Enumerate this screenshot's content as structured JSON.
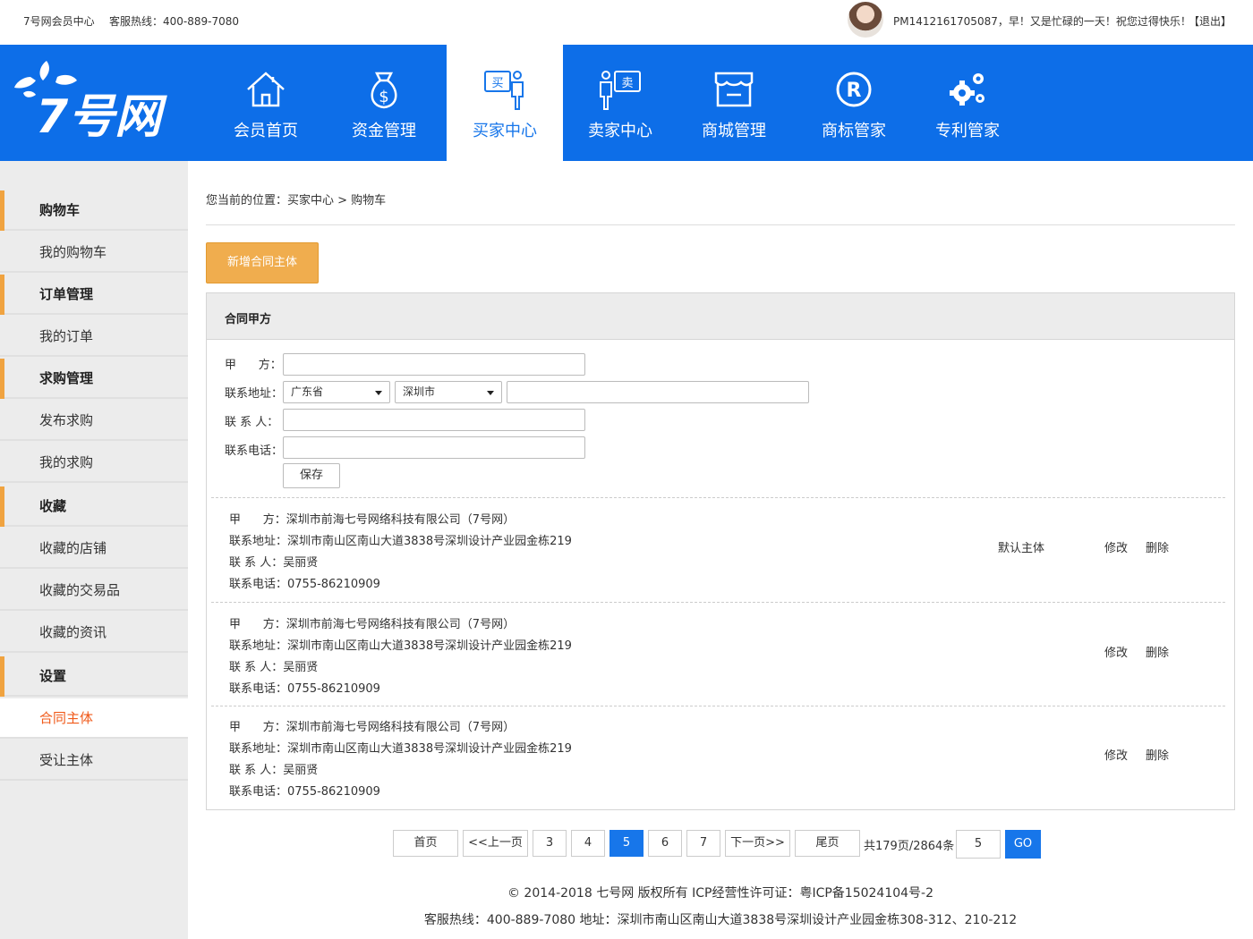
{
  "topbar": {
    "site_name": "7号网会员中心",
    "hotline": "客服热线：400-889-7080",
    "greeting": "PM1412161705087，早！又是忙碌的一天！祝您过得快乐！",
    "logout": "【退出】"
  },
  "logo": {
    "text": "7号网"
  },
  "nav": {
    "items": [
      {
        "label": "会员首页",
        "icon": "home-icon"
      },
      {
        "label": "资金管理",
        "icon": "money-bag-icon"
      },
      {
        "label": "买家中心",
        "icon": "buyer-icon",
        "active": true
      },
      {
        "label": "卖家中心",
        "icon": "seller-icon"
      },
      {
        "label": "商城管理",
        "icon": "store-icon"
      },
      {
        "label": "商标管家",
        "icon": "trademark-icon"
      },
      {
        "label": "专利管家",
        "icon": "gears-icon"
      }
    ]
  },
  "sidebar": {
    "items": [
      {
        "label": "购物车",
        "type": "head"
      },
      {
        "label": "我的购物车",
        "type": "item"
      },
      {
        "label": "订单管理",
        "type": "head"
      },
      {
        "label": "我的订单",
        "type": "item"
      },
      {
        "label": "求购管理",
        "type": "head"
      },
      {
        "label": "发布求购",
        "type": "item"
      },
      {
        "label": "我的求购",
        "type": "item"
      },
      {
        "label": "收藏",
        "type": "head"
      },
      {
        "label": "收藏的店铺",
        "type": "item"
      },
      {
        "label": "收藏的交易品",
        "type": "item"
      },
      {
        "label": "收藏的资讯",
        "type": "item"
      },
      {
        "label": "设置",
        "type": "head"
      },
      {
        "label": "合同主体",
        "type": "item",
        "active": true
      },
      {
        "label": "受让主体",
        "type": "item"
      }
    ]
  },
  "breadcrumb": "您当前的位置：买家中心 >  购物车",
  "add_button": "新增合同主体",
  "panel": {
    "title": "合同甲方",
    "form": {
      "party_label": "甲      方：",
      "address_label": "联系地址：",
      "contact_label": "联 系 人：",
      "phone_label": "联系电话：",
      "province": "广东省",
      "city": "深圳市",
      "party_value": "",
      "address_value": "",
      "contact_value": "",
      "phone_value": "",
      "save": "保存"
    },
    "records": [
      {
        "party": "甲      方：深圳市前海七号网络科技有限公司（7号网）",
        "address": "联系地址：深圳市南山区南山大道3838号深圳设计产业园金栋219",
        "contact": "联 系 人：吴丽贤",
        "phone": "联系电话：0755-86210909",
        "default": "默认主体",
        "edit": "修改",
        "delete": "删除"
      },
      {
        "party": "甲      方：深圳市前海七号网络科技有限公司（7号网）",
        "address": "联系地址：深圳市南山区南山大道3838号深圳设计产业园金栋219",
        "contact": "联 系 人：吴丽贤",
        "phone": "联系电话：0755-86210909",
        "default": "",
        "edit": "修改",
        "delete": "删除"
      },
      {
        "party": "甲      方：深圳市前海七号网络科技有限公司（7号网）",
        "address": "联系地址：深圳市南山区南山大道3838号深圳设计产业园金栋219",
        "contact": "联 系 人：吴丽贤",
        "phone": "联系电话：0755-86210909",
        "default": "",
        "edit": "修改",
        "delete": "删除"
      }
    ]
  },
  "pager": {
    "first": "首页",
    "prev": "<<上一页",
    "pages": [
      "3",
      "4",
      "5",
      "6",
      "7"
    ],
    "current": "5",
    "next": "下一页>>",
    "last": "尾页",
    "info": "共179页/2864条",
    "jump_value": "5",
    "go": "GO"
  },
  "footer": {
    "line1": "© 2014-2018 七号网 版权所有 ICP经营性许可证：粤ICP备15024104号-2",
    "line2": "客服热线：400-889-7080  地址：深圳市南山区南山大道3838号深圳设计产业园金栋308-312、210-212"
  },
  "colors": {
    "brand_blue": "#0d6ee8",
    "accent_orange": "#f0ad4e",
    "active_red": "#f05a1a"
  }
}
